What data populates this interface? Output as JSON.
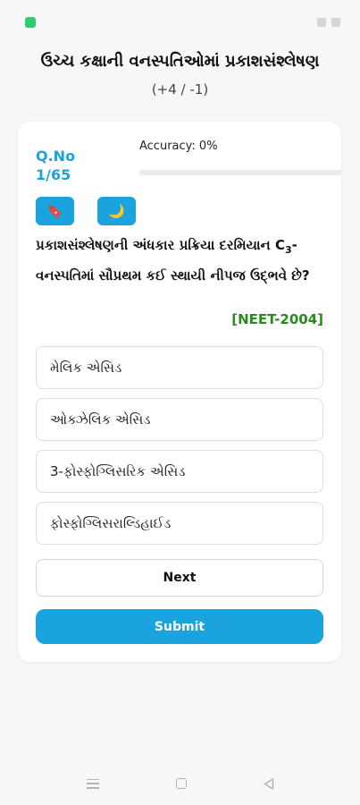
{
  "header": {
    "title": "ઉચ્ચ કક્ષાની વનસ્પતિઓમાં પ્રકાશસંશ્લેષણ",
    "marking_scheme": "(+4 / -1)"
  },
  "quiz": {
    "qno_label": "Q.No",
    "qno_value": "1/65",
    "accuracy_text": "Accuracy: 0%",
    "accuracy_fraction": 0,
    "question_prefix": "પ્રકાશસંશ્લેષણની અંધકાર પ્રક્રિયા દરમિયાન C",
    "question_subscript": "3",
    "question_suffix": "-વનસ્પતિમાં સૌપ્રથમ કઈ સ્થાયી નીપજ ઉદ્ભવે છે?",
    "source": "[NEET-2004]",
    "options": [
      {
        "label": "મેલિક એસિડ"
      },
      {
        "label": "ઓક્ઝેલિક એસિડ"
      },
      {
        "label": "3-ફોસ્ફોગ્લિસરિક એસિડ"
      },
      {
        "label": "ફોસ્ફોગ્લિસરાલ્ડિહાઈડ"
      }
    ],
    "next_label": "Next",
    "submit_label": "Submit"
  },
  "icons": {
    "bookmark": "🔖",
    "theme": "🌙"
  },
  "colors": {
    "accent": "#1aa3dd",
    "source_tag": "#2a8a1e"
  }
}
